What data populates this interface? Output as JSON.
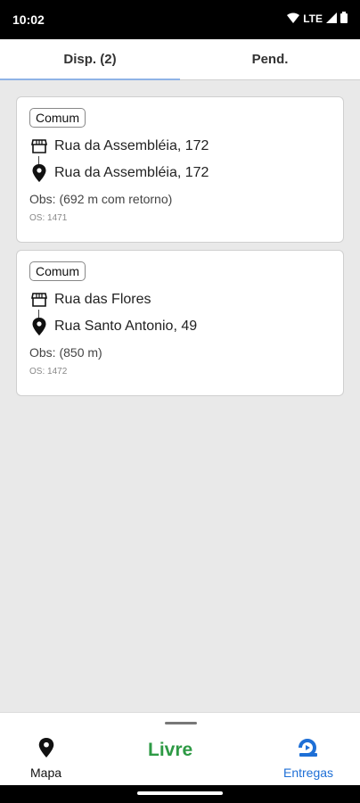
{
  "status_bar": {
    "time": "10:02",
    "network": "LTE"
  },
  "tabs": [
    {
      "label": "Disp. (2)",
      "active": true
    },
    {
      "label": "Pend.",
      "active": false
    }
  ],
  "cards": [
    {
      "badge": "Comum",
      "origin": "Rua da Assembléia, 172",
      "destination": "Rua da Assembléia, 172",
      "obs": "Obs:  (692 m com retorno)",
      "os": "OS: 1471"
    },
    {
      "badge": "Comum",
      "origin": "Rua das Flores",
      "destination": "Rua Santo Antonio, 49",
      "obs": "Obs:  (850 m)",
      "os": "OS: 1472"
    }
  ],
  "bottom_nav": {
    "mapa": "Mapa",
    "status": "Livre",
    "entregas": "Entregas"
  },
  "colors": {
    "status_green": "#2e9a45",
    "accent_blue": "#1e6fd6",
    "tab_indicator": "#8fb3e6"
  }
}
